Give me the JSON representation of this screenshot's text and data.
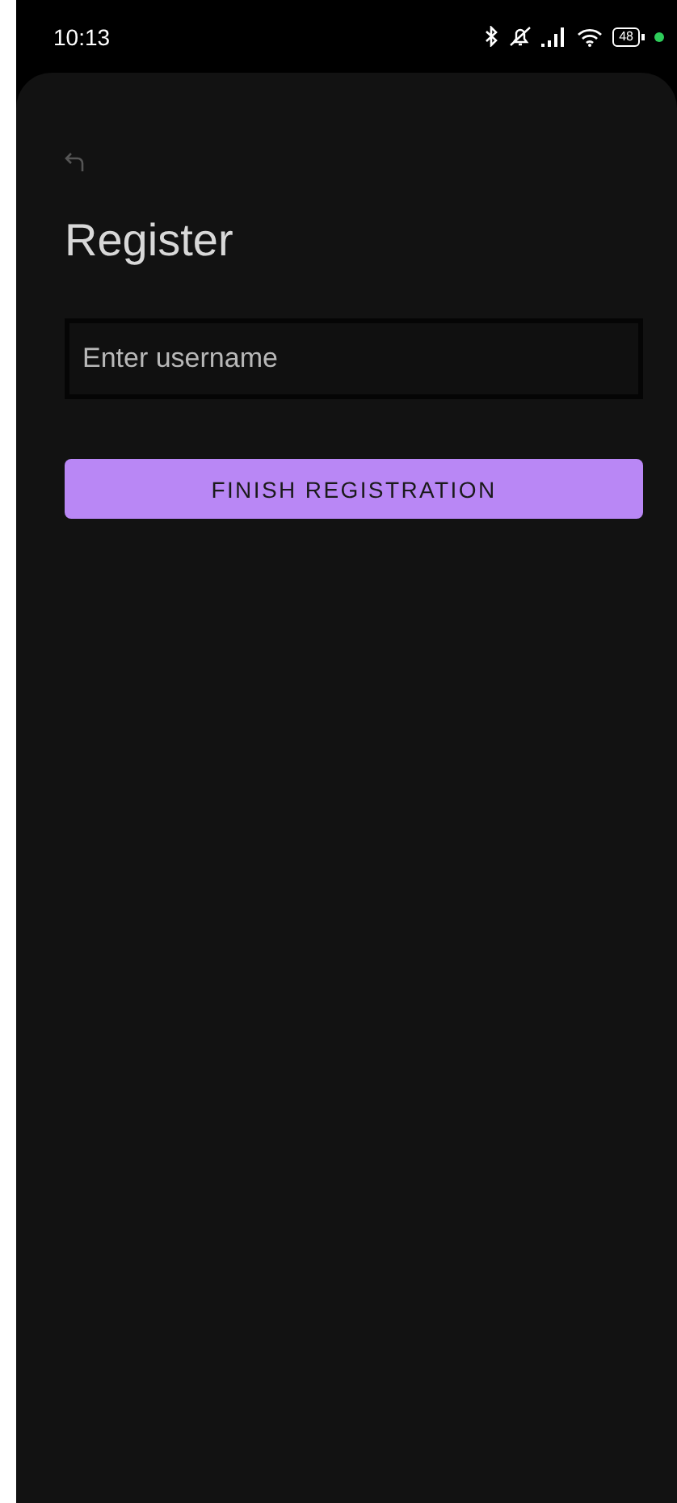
{
  "status_bar": {
    "time": "10:13",
    "battery": "48"
  },
  "title": "Register",
  "username_field": {
    "placeholder": "Enter username"
  },
  "buttons": [
    "FINISH REGISTRATION"
  ]
}
